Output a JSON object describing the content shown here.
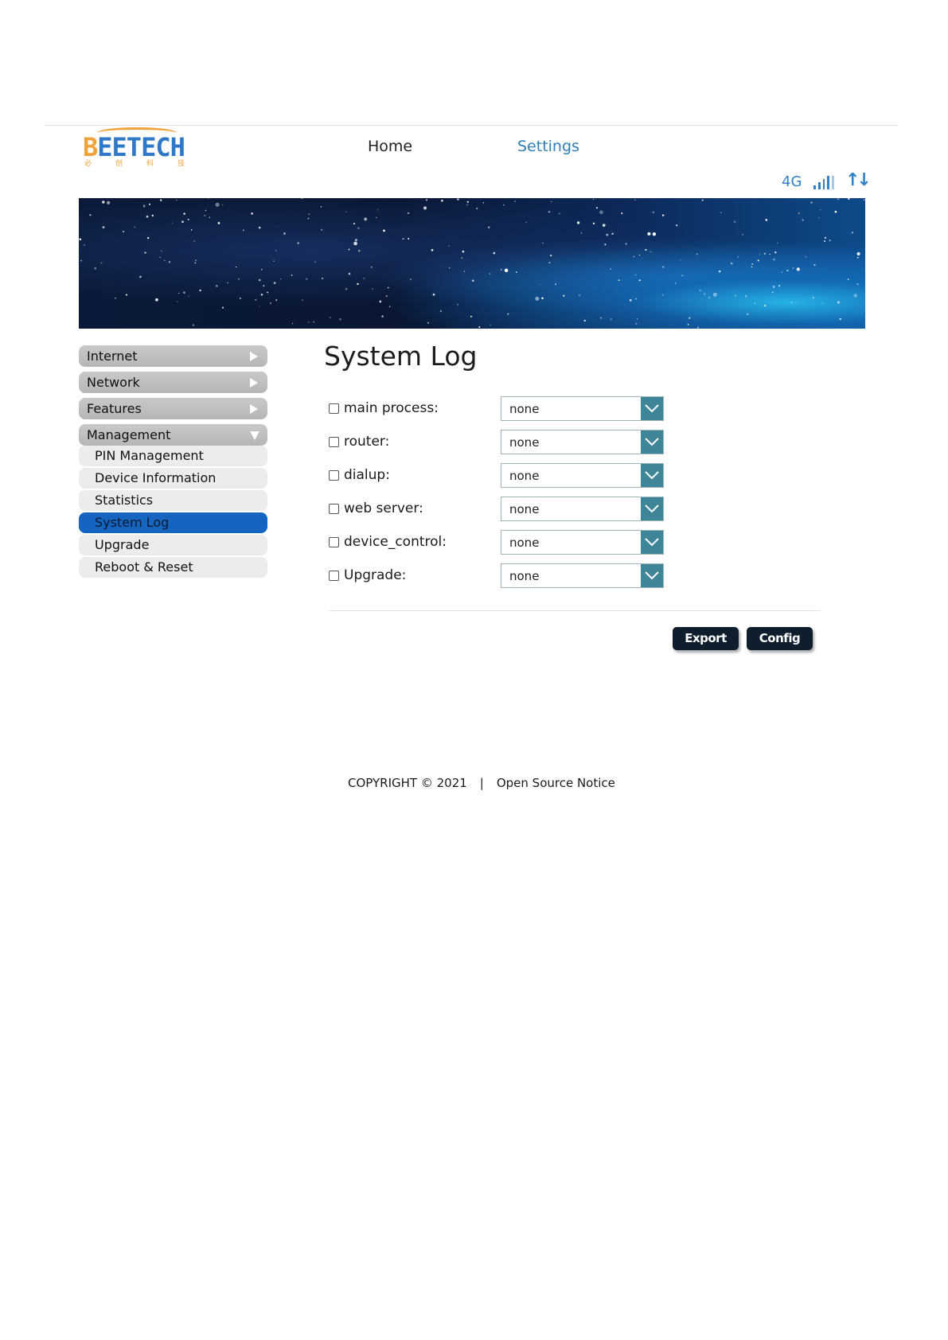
{
  "brand": {
    "logo_text_first": "B",
    "logo_text_rest": "EETECH",
    "logo_sub": [
      "必",
      "创",
      "科",
      "技"
    ],
    "accent": "#f0a33a",
    "blue": "#2f78c8"
  },
  "nav": {
    "home": "Home",
    "settings": "Settings"
  },
  "status": {
    "network_type": "4G",
    "signal_icon": "signal-bars-icon",
    "transfer_icon": "up-down-arrows-icon",
    "transfer_glyph": "↑↓"
  },
  "sidebar": {
    "items": [
      {
        "label": "Internet",
        "state": "collapsed"
      },
      {
        "label": "Network",
        "state": "collapsed"
      },
      {
        "label": "Features",
        "state": "collapsed"
      },
      {
        "label": "Management",
        "state": "expanded"
      }
    ],
    "management_sub": [
      {
        "label": "PIN Management"
      },
      {
        "label": "Device Information"
      },
      {
        "label": "Statistics"
      },
      {
        "label": "System Log",
        "active": true
      },
      {
        "label": "Upgrade"
      },
      {
        "label": "Reboot & Reset"
      }
    ],
    "active_color": "#1565c0"
  },
  "main": {
    "title": "System Log",
    "rows": [
      {
        "label": "main process:",
        "value": "none",
        "checked": false
      },
      {
        "label": "router:",
        "value": "none",
        "checked": false
      },
      {
        "label": "dialup:",
        "value": "none",
        "checked": false
      },
      {
        "label": "web server:",
        "value": "none",
        "checked": false
      },
      {
        "label": "device_control:",
        "value": "none",
        "checked": false
      },
      {
        "label": "Upgrade:",
        "value": "none",
        "checked": false
      }
    ],
    "buttons": {
      "export": "Export",
      "config": "Config"
    }
  },
  "footer": {
    "copyright": "COPYRIGHT © 2021",
    "separator": "|",
    "notice": "Open Source Notice"
  }
}
